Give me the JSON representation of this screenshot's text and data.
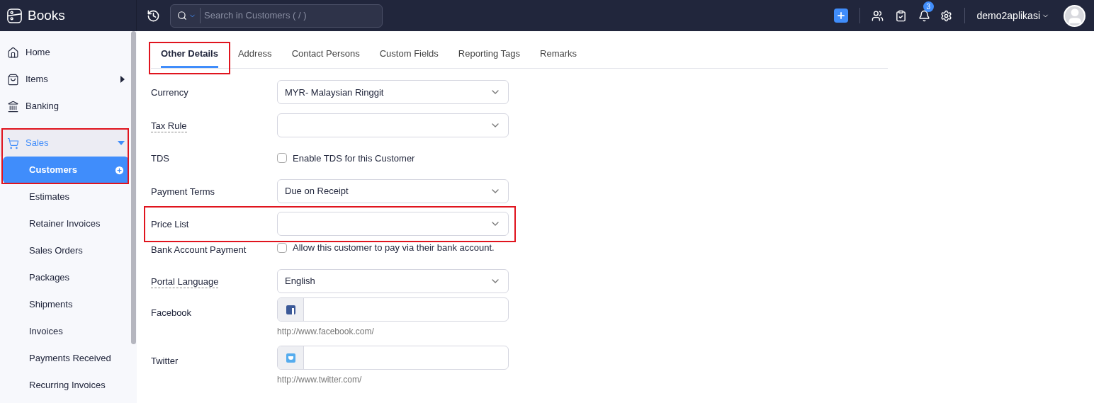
{
  "header": {
    "brand": "Books",
    "search": {
      "placeholder": "Search in Customers ( / )"
    },
    "notification_count": "3",
    "user": "demo2aplikasi"
  },
  "sidebar": {
    "items": [
      {
        "label": "Home",
        "kind": "top",
        "selected": false
      },
      {
        "label": "Items",
        "kind": "top",
        "selected": false,
        "expanded": false
      },
      {
        "label": "Banking",
        "kind": "top",
        "selected": false
      },
      {
        "label": "Sales",
        "kind": "group",
        "selected": true,
        "expanded": true,
        "highlighted": true,
        "children": [
          {
            "label": "Customers",
            "selected": true
          },
          {
            "label": "Estimates",
            "selected": false
          },
          {
            "label": "Retainer Invoices",
            "selected": false
          },
          {
            "label": "Sales Orders",
            "selected": false
          },
          {
            "label": "Packages",
            "selected": false
          },
          {
            "label": "Shipments",
            "selected": false
          },
          {
            "label": "Invoices",
            "selected": false
          },
          {
            "label": "Payments Received",
            "selected": false
          },
          {
            "label": "Recurring Invoices",
            "selected": false
          }
        ]
      }
    ]
  },
  "tabs": [
    {
      "label": "Other Details",
      "selected": true,
      "highlighted": true
    },
    {
      "label": "Address",
      "selected": false,
      "highlighted": false
    },
    {
      "label": "Contact Persons",
      "selected": false,
      "highlighted": false
    },
    {
      "label": "Custom Fields",
      "selected": false,
      "highlighted": false
    },
    {
      "label": "Reporting Tags",
      "selected": false,
      "highlighted": false
    },
    {
      "label": "Remarks",
      "selected": false,
      "highlighted": false
    }
  ],
  "fields": [
    {
      "label": "Currency",
      "kind": "select",
      "value": "MYR- Malaysian Ringgit",
      "underlined": false,
      "highlighted": false
    },
    {
      "label": "Tax Rule",
      "kind": "select",
      "underlined": true,
      "highlighted": false
    },
    {
      "label": "TDS",
      "kind": "checkbox",
      "text": "Enable TDS for this Customer",
      "checked": false,
      "underlined": false,
      "highlighted": false
    },
    {
      "label": "Payment Terms",
      "kind": "select",
      "value": "Due on Receipt",
      "underlined": false,
      "highlighted": false
    },
    {
      "label": "Price List",
      "kind": "select",
      "underlined": false,
      "highlighted": true
    },
    {
      "label": "Bank Account Payment",
      "kind": "checkbox",
      "text": "Allow this customer to pay via their bank account.",
      "checked": false,
      "underlined": false,
      "highlighted": false
    },
    {
      "label": "Portal Language",
      "kind": "select",
      "value": "English",
      "underlined": true,
      "highlighted": false
    },
    {
      "label": "Facebook",
      "kind": "facebook",
      "hint": "http://www.facebook.com/",
      "underlined": false,
      "highlighted": false
    },
    {
      "label": "Twitter",
      "kind": "twitter",
      "hint": "http://www.twitter.com/",
      "underlined": false,
      "highlighted": false
    }
  ]
}
